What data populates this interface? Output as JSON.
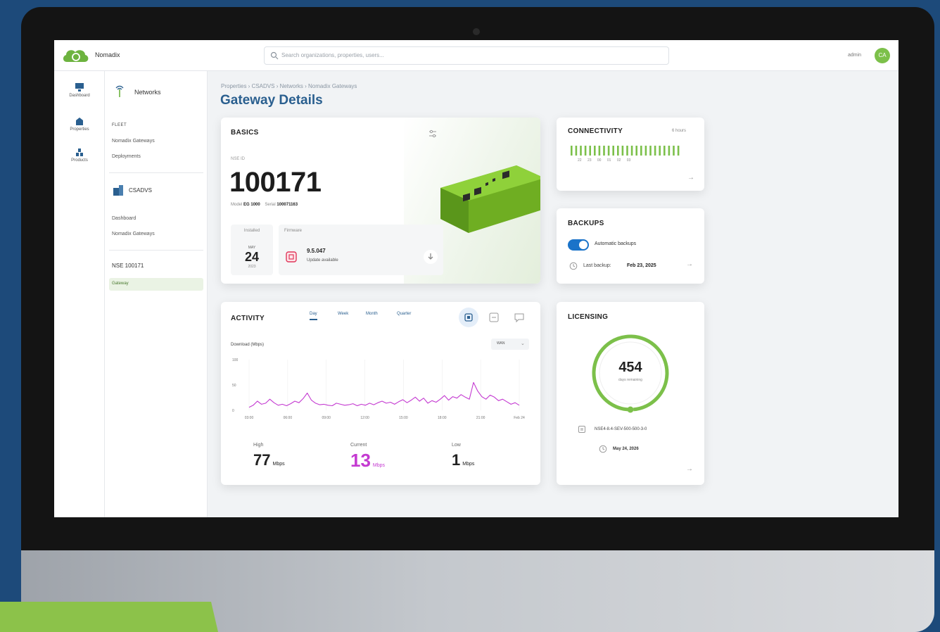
{
  "app": {
    "brand": "Nomadix",
    "search_placeholder": "Search organizations, properties, users...",
    "user_name": "admin",
    "user_initials": "CA"
  },
  "rail": {
    "items": [
      {
        "label": "Dashboard",
        "icon": "dashboard-icon"
      },
      {
        "label": "Properties",
        "icon": "properties-icon"
      },
      {
        "label": "Products",
        "icon": "products-icon"
      }
    ]
  },
  "nav": {
    "header": "Networks",
    "fleet_section": "FLEET",
    "fleet_links": [
      "Nomadix Gateways",
      "Deployments"
    ],
    "property_name": "CSADVS",
    "property_links": [
      "Dashboard",
      "Nomadix Gateways"
    ],
    "device_name": "NSE 100171",
    "device_active": "Gateway"
  },
  "page": {
    "breadcrumb": "Properties  ›  CSADVS  ›  Networks  ›  Nomadix Gateways",
    "title": "Gateway Details"
  },
  "basics": {
    "title": "BASICS",
    "nse_label": "NSE ID",
    "nse_id": "100171",
    "model_label": "Model",
    "model_value": "EG 1000",
    "serial_label": "Serial",
    "serial_value": "100071163",
    "installed_label": "Installed",
    "installed_month": "MAY",
    "installed_day": "24",
    "installed_year": "2023",
    "firmware_label": "Firmware",
    "firmware_version": "9.5.047",
    "firmware_status": "Update available"
  },
  "connectivity": {
    "title": "CONNECTIVITY",
    "range": "6 hours",
    "ticks": [
      "22",
      "23",
      "00",
      "01",
      "02",
      "03"
    ]
  },
  "backups": {
    "title": "BACKUPS",
    "auto_label": "Automatic backups",
    "auto_enabled": true,
    "last_label": "Last backup:",
    "last_value": "Feb 23, 2025"
  },
  "activity": {
    "title": "ACTIVITY",
    "tabs": [
      "Day",
      "Week",
      "Month",
      "Quarter"
    ],
    "active_tab": "Day",
    "metric_label": "Download (Mbps)",
    "dropdown": "WAN",
    "accent": "#c43ad1",
    "stats": [
      {
        "label": "High",
        "value": "77",
        "unit": "Mbps"
      },
      {
        "label": "Current",
        "value": "13",
        "unit": "Mbps"
      },
      {
        "label": "Low",
        "value": "1",
        "unit": "Mbps"
      }
    ]
  },
  "chart_data": {
    "type": "line",
    "x_ticks": [
      "03:00",
      "06:00",
      "09:00",
      "12:00",
      "15:00",
      "18:00",
      "21:00",
      "Feb 24"
    ],
    "y_ticks": [
      "100",
      "50",
      "0"
    ],
    "ylim": [
      0,
      100
    ],
    "series": [
      {
        "color": "#c43ad1",
        "values": [
          6,
          10,
          18,
          12,
          14,
          22,
          15,
          10,
          12,
          9,
          13,
          18,
          15,
          23,
          34,
          20,
          14,
          11,
          12,
          10,
          9,
          14,
          12,
          10,
          11,
          13,
          9,
          12,
          10,
          14,
          11,
          15,
          18,
          14,
          16,
          12,
          17,
          21,
          15,
          20,
          26,
          18,
          24,
          14,
          19,
          16,
          22,
          29,
          20,
          27,
          24,
          31,
          26,
          22,
          55,
          38,
          27,
          22,
          30,
          26,
          19,
          22,
          17,
          12,
          15,
          10
        ]
      }
    ]
  },
  "licensing": {
    "title": "LICENSING",
    "days": "454",
    "days_label": "days remaining",
    "progress": 0.98,
    "key": "NSE4-8.4-SEV-500-500-3-0",
    "expiry": "May 24, 2026"
  },
  "colors": {
    "primary": "#2a5f8f",
    "green": "#7cc04a",
    "toggle": "#1a73c9",
    "highlight": "#c43ad1"
  }
}
